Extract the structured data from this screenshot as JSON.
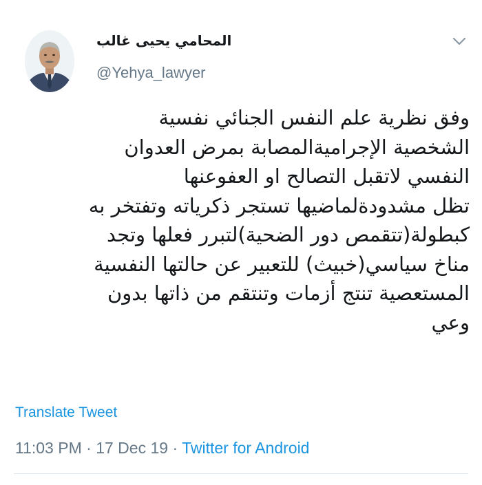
{
  "tweet": {
    "author": {
      "display_name": "المحامي يحيى غالب",
      "handle": "@Yehya_lawyer"
    },
    "body_lines": [
      "وفق نظرية علم النفس الجنائي نفسية",
      "الشخصية الإجراميةالمصابة بمرض العدوان",
      "النفسي لاتقبل التصالح او العفوعنها",
      "تظل مشدودةلماضيها تستجر ذكرياته وتفتخر به",
      "كبطولة(تتقمص دور الضحية)لتبرر فعلها وتجد",
      "مناخ سياسي(خبيث) للتعبير عن حالتها النفسية",
      "المستعصية تنتج أزمات وتنتقم من ذاتها بدون",
      "وعي"
    ],
    "translate_label": "Translate Tweet",
    "time": "11:03 PM",
    "separator": "·",
    "date": "17 Dec 19",
    "source": "Twitter for Android"
  },
  "icons": {
    "menu": "chevron-down-icon"
  },
  "colors": {
    "text": "#14171a",
    "secondary": "#657786",
    "link": "#1b95e0",
    "divider": "#e1e8ed"
  }
}
